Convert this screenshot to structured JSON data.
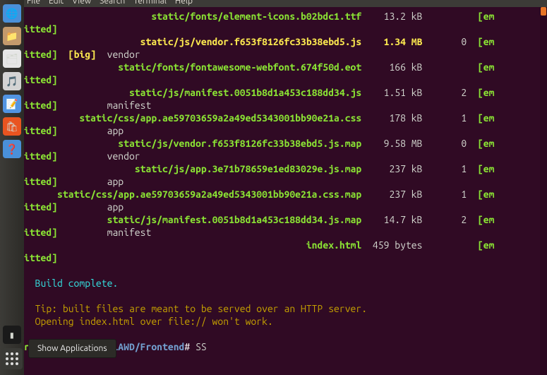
{
  "menubar": {
    "items": [
      "File",
      "Edit",
      "View",
      "Search",
      "Terminal",
      "Help"
    ]
  },
  "lines": [
    {
      "asset": "static/fonts/element-icons.b02bdc1.ttf",
      "asset_cls": "green",
      "size": "13.2 kB",
      "chunks": "",
      "em": "[em"
    },
    {
      "wrap": "itted]",
      "extra": ""
    },
    {
      "asset": "static/js/vendor.f653f8126fc33b38ebd5.js",
      "asset_cls": "yellow",
      "size": "1.34 MB",
      "size_cls": "yellow",
      "chunks": "0",
      "em": "[em"
    },
    {
      "wrap": "itted]",
      "big": "[big]",
      "extra": "vendor"
    },
    {
      "asset": "static/fonts/fontawesome-webfont.674f50d.eot",
      "asset_cls": "green",
      "size": "166 kB",
      "chunks": "",
      "em": "[em"
    },
    {
      "wrap": "itted]",
      "extra": ""
    },
    {
      "asset": "static/js/manifest.0051b8d1a453c188dd34.js",
      "asset_cls": "green",
      "size": "1.51 kB",
      "chunks": "2",
      "em": "[em"
    },
    {
      "wrap": "itted]",
      "extra": "manifest"
    },
    {
      "asset": "static/css/app.ae59703659a2a49ed5343001bb90e21a.css",
      "asset_cls": "green",
      "size": "178 kB",
      "chunks": "1",
      "em": "[em"
    },
    {
      "wrap": "itted]",
      "extra": "app"
    },
    {
      "asset": "static/js/vendor.f653f8126fc33b38ebd5.js.map",
      "asset_cls": "green",
      "size": "9.58 MB",
      "chunks": "0",
      "em": "[em"
    },
    {
      "wrap": "itted]",
      "extra": "vendor"
    },
    {
      "asset": "static/js/app.3e71b78659e1ed83029e.js.map",
      "asset_cls": "green",
      "size": "237 kB",
      "chunks": "1",
      "em": "[em"
    },
    {
      "wrap": "itted]",
      "extra": "app"
    },
    {
      "asset": "static/css/app.ae59703659a2a49ed5343001bb90e21a.css.map",
      "asset_cls": "green",
      "size": "237 kB",
      "chunks": "1",
      "em": "[em"
    },
    {
      "wrap": "itted]",
      "extra": "app"
    },
    {
      "asset": "static/js/manifest.0051b8d1a453c188dd34.js.map",
      "asset_cls": "green",
      "size": "14.7 kB",
      "chunks": "2",
      "em": "[em"
    },
    {
      "wrap": "itted]",
      "extra": "manifest"
    },
    {
      "asset": "index.html",
      "asset_cls": "green",
      "size": "459 bytes",
      "chunks": "",
      "em": "[em"
    },
    {
      "wrap": "itted]",
      "extra": ""
    }
  ],
  "footer": {
    "blank": "",
    "complete": "  Build complete.",
    "tip1": "  Tip: built files are meant to be served over an HTTP server.",
    "tip2": "  Opening index.html over file:// won't work."
  },
  "prompt": {
    "user": "root@ubuntu",
    "sep": ":",
    "path": "~/AoiAWD/Frontend",
    "hash": "# ",
    "cmd": "SS"
  },
  "tooltip": "Show Applications",
  "launcher_colors": [
    "#4a90d9",
    "#c49a6c",
    "#e6e6e6",
    "#34e2e2",
    "#5294e2",
    "#e95420",
    "#4a90d9",
    "#3a3a36"
  ]
}
